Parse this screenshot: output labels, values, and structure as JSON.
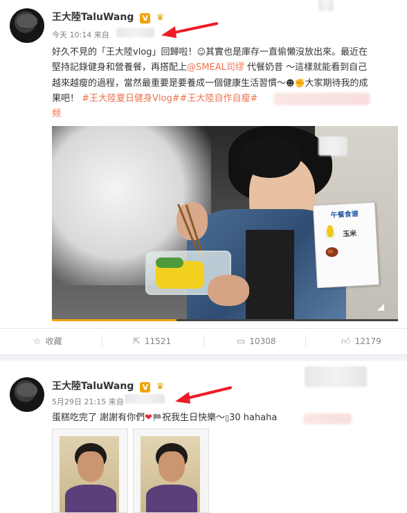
{
  "post1": {
    "author": "王大陸TaluWang",
    "verified_badge": "V",
    "time": "今天 10:14 来自",
    "text_lines": [
      "好久不見的「王大陸vlog」回歸啦！",
      "其實也是庫存一直偷懶沒放出來。最近在",
      "堅持記錄健身和營養餐，再搭配上",
      "@SMEAL司缪",
      " 代餐奶昔 ～這樣就能看到自己",
      "越來越瘦的過程，當然最重要是要養成一個健康生活習慣～",
      "大家期待我的成",
      "果吧！",
      "#王大陸夏日健身Vlog##王大陸自作自瘦#",
      "频"
    ],
    "video": {
      "card_title": "午餐食谱",
      "card_item": "玉米"
    },
    "actions": {
      "favorite": "收藏",
      "repost": "11521",
      "comment": "10308",
      "like": "12179"
    }
  },
  "post2": {
    "author": "王大陸TaluWang",
    "verified_badge": "V",
    "time": "5月29日 21:15 来自",
    "text_a": "蛋糕吃完了 謝謝有你們",
    "text_b": "祝我生日快樂～",
    "text_c": "30 hahaha"
  },
  "icons": {
    "annotation_arrow_color": "#ee1c25",
    "accent": "#eb7350",
    "progress": "#f0a30a"
  }
}
